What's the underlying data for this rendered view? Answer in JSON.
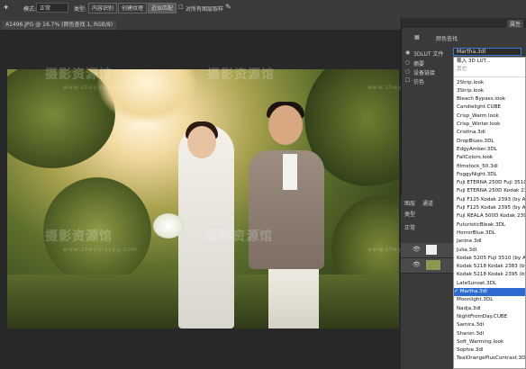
{
  "options_bar": {
    "mode_label": "模式:",
    "mode_value": "正常",
    "type_label": "类型:",
    "content_aware": "内容识别",
    "create_texture": "创建纹理",
    "proximity_match": "近似匹配",
    "sample_all_layers": "对所有图层取样"
  },
  "document_tab": {
    "title": "A1496.JPG @ 16.7% (颜色查找 1, RGB/8)"
  },
  "watermarks": {
    "brand": "摄影资源馆",
    "url": "www.sheyingzyg.com"
  },
  "properties_panel": {
    "tab_title": "属性",
    "adjustment_name": "颜色查找",
    "lut_file_label": "3DLUT 文件",
    "lut_selected": "Martha.3dl",
    "abstract_label": "摘要",
    "device_link_label": "设备链接",
    "dither_label": "仿色"
  },
  "layers_panel": {
    "tab1": "图层",
    "tab2": "通道",
    "kind": "类型",
    "blend": "正常"
  },
  "lut_dropdown": {
    "load": "载入 3D LUT...",
    "other": "其它",
    "options": [
      "2Strip.look",
      "3Strip.look",
      "Bleach Bypass.look",
      "Candlelight.CUBE",
      "Crisp_Warm.look",
      "Crisp_Winter.look",
      "Cristina.3dl",
      "DropBlues.3DL",
      "EdgyAmber.3DL",
      "FallColors.look",
      "filmstock_50.3dl",
      "FoggyNight.3DL",
      "Fuji ETERNA 250D Fuji 3510 (by",
      "Fuji ETERNA 250D Kodak 2395",
      "Fuji F125 Kodak 2393 (by Ado",
      "Fuji F125 Kodak 2395 (by Ado",
      "Fuji REALA 500D Kodak 2393 (",
      "FuturisticBleak.3DL",
      "HorrorBlue.3DL",
      "Janine.3dl",
      "Julia.3dl",
      "Kodak 5205 Fuji 3510 (by Ado",
      "Kodak 5218 Kodak 2383 (by A",
      "Kodak 5218 Kodak 2395 (by A",
      "LateSunset.3DL",
      "Martha.3dl",
      "Moonlight.3DL",
      "Nadja.3dl",
      "NightFromDay.CUBE",
      "Samira.3dl",
      "Sharon.3dl",
      "Soft_Warming.look",
      "Sophie.3dl",
      "TealOrangePlusContrast.3DL"
    ],
    "selected_index": 25,
    "selected_color": "#2d6bd2"
  }
}
